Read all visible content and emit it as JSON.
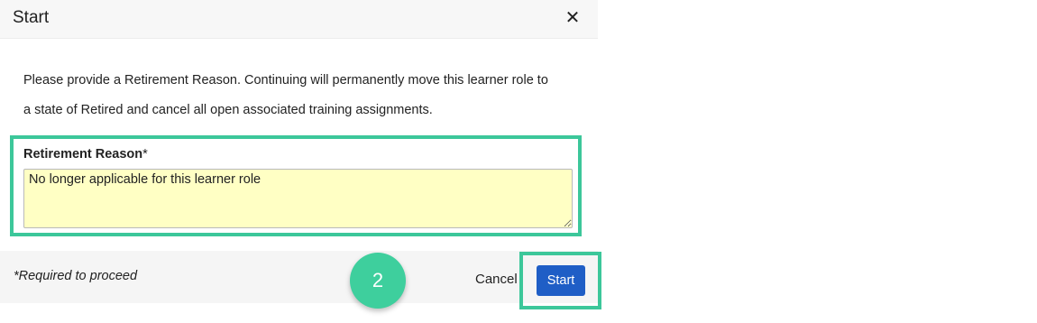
{
  "dialog": {
    "title": "Start",
    "close_glyph": "✕",
    "message_line1": "Please provide a Retirement Reason. Continuing will permanently move this learner role to",
    "message_line2": "a state of Retired and cancel all open associated training assignments."
  },
  "form": {
    "reason_label": "Retirement Reason",
    "required_marker": "*",
    "reason_value": "No longer applicable for this learner role",
    "field_background": "#ffffc4"
  },
  "footer": {
    "required_note": "*Required to proceed",
    "cancel_label": "Cancel",
    "start_label": "Start"
  },
  "annotation": {
    "step_number": "2",
    "highlight_color": "#3cc79a"
  },
  "colors": {
    "primary_button": "#1f5ec6",
    "step_badge": "#3ecf9d"
  }
}
